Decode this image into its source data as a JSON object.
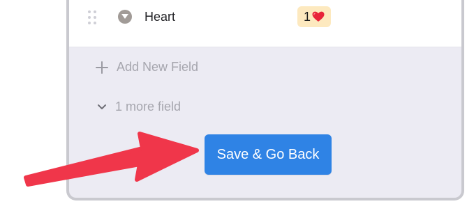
{
  "field_row": {
    "name": "Heart",
    "badge_count": "1",
    "badge_icon": "heart-icon",
    "badge_color": "#fde9bf"
  },
  "actions": {
    "add_field_label": "Add New Field",
    "more_fields_label": "1 more field",
    "save_label": "Save & Go Back"
  },
  "colors": {
    "primary_button": "#2f83e5",
    "annotation_arrow": "#f0364a",
    "panel_background": "#ecebf3"
  }
}
